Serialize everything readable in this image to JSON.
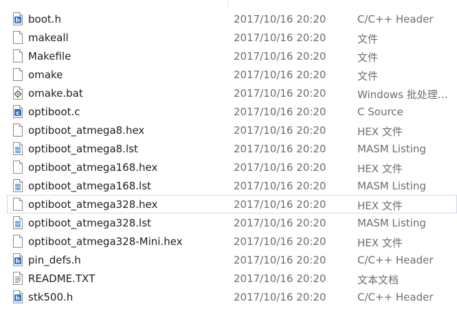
{
  "files": [
    {
      "name": "boot.h",
      "date": "2017/10/16 20:20",
      "type": "C/C++ Header",
      "icon": "h-file-icon",
      "selected": false
    },
    {
      "name": "makeall",
      "date": "2017/10/16 20:20",
      "type": "文件",
      "icon": "blank-file-icon",
      "selected": false
    },
    {
      "name": "Makefile",
      "date": "2017/10/16 20:20",
      "type": "文件",
      "icon": "blank-file-icon",
      "selected": false
    },
    {
      "name": "omake",
      "date": "2017/10/16 20:20",
      "type": "文件",
      "icon": "blank-file-icon",
      "selected": false
    },
    {
      "name": "omake.bat",
      "date": "2017/10/16 20:20",
      "type": "Windows 批处理…",
      "icon": "batch-file-icon",
      "selected": false
    },
    {
      "name": "optiboot.c",
      "date": "2017/10/16 20:20",
      "type": "C Source",
      "icon": "c-file-icon",
      "selected": false
    },
    {
      "name": "optiboot_atmega8.hex",
      "date": "2017/10/16 20:20",
      "type": "HEX 文件",
      "icon": "blank-file-icon",
      "selected": false
    },
    {
      "name": "optiboot_atmega8.lst",
      "date": "2017/10/16 20:20",
      "type": "MASM Listing",
      "icon": "listing-file-icon",
      "selected": false
    },
    {
      "name": "optiboot_atmega168.hex",
      "date": "2017/10/16 20:20",
      "type": "HEX 文件",
      "icon": "blank-file-icon",
      "selected": false
    },
    {
      "name": "optiboot_atmega168.lst",
      "date": "2017/10/16 20:20",
      "type": "MASM Listing",
      "icon": "listing-file-icon",
      "selected": false
    },
    {
      "name": "optiboot_atmega328.hex",
      "date": "2017/10/16 20:20",
      "type": "HEX 文件",
      "icon": "blank-file-icon",
      "selected": true
    },
    {
      "name": "optiboot_atmega328.lst",
      "date": "2017/10/16 20:20",
      "type": "MASM Listing",
      "icon": "listing-file-icon",
      "selected": false
    },
    {
      "name": "optiboot_atmega328-Mini.hex",
      "date": "2017/10/16 20:20",
      "type": "HEX 文件",
      "icon": "blank-file-icon",
      "selected": false
    },
    {
      "name": "pin_defs.h",
      "date": "2017/10/16 20:20",
      "type": "C/C++ Header",
      "icon": "h-file-icon",
      "selected": false
    },
    {
      "name": "README.TXT",
      "date": "2017/10/16 20:20",
      "type": "文本文档",
      "icon": "text-file-icon",
      "selected": false
    },
    {
      "name": "stk500.h",
      "date": "2017/10/16 20:20",
      "type": "C/C++ Header",
      "icon": "h-file-icon",
      "selected": false
    }
  ],
  "colors": {
    "selection_border": "#cdd8e6",
    "secondary_text": "#6d6d6d",
    "primary_text": "#1e1e1e",
    "code_icon_blue": "#2b6fc2"
  }
}
